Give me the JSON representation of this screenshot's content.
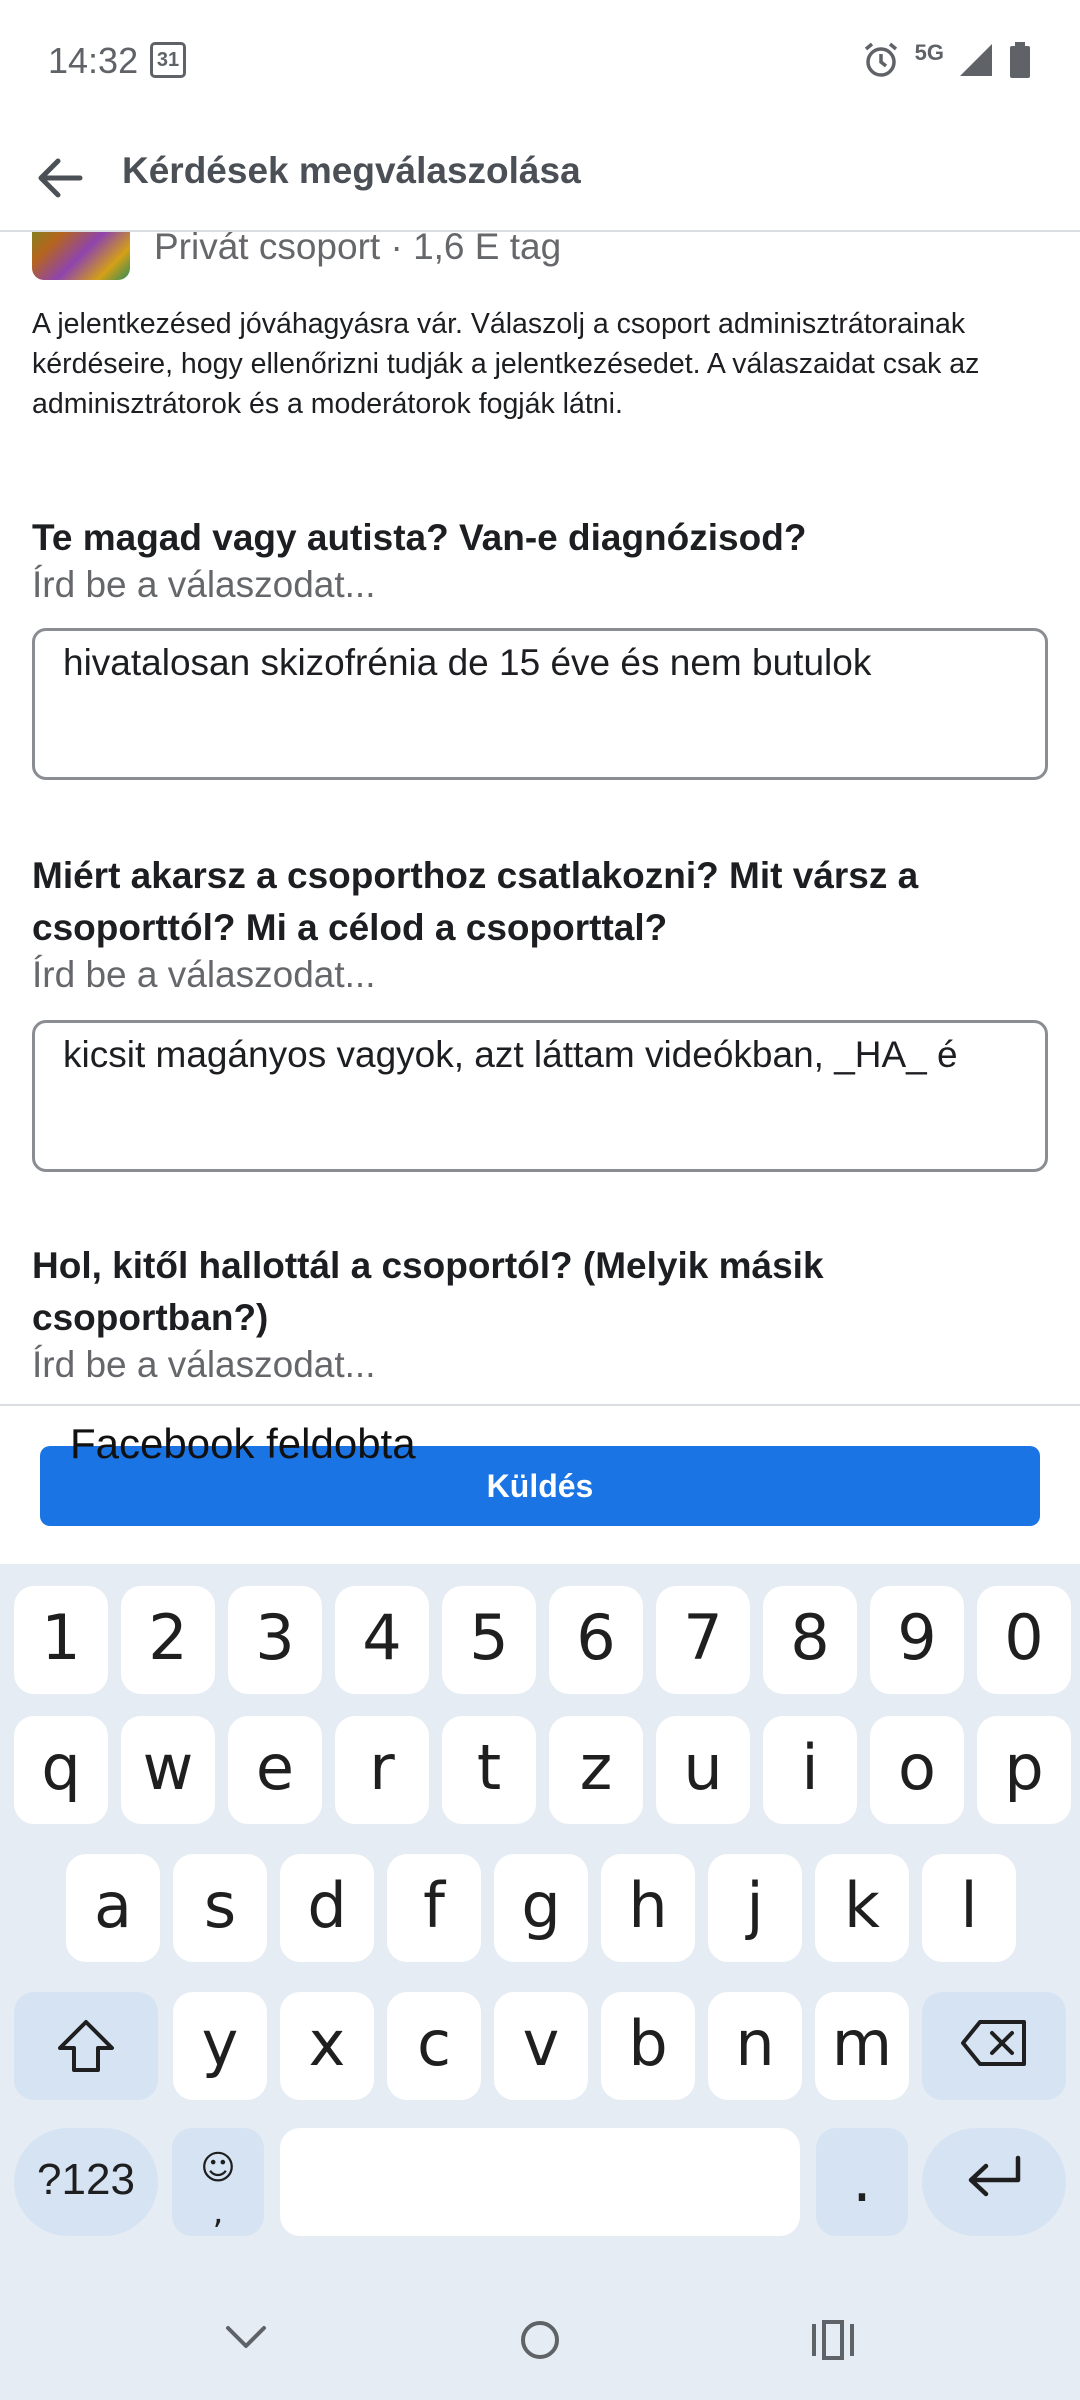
{
  "status_bar": {
    "time": "14:32",
    "calendar_day": "31",
    "network": "5G"
  },
  "header": {
    "title": "Kérdések megválaszolása"
  },
  "group": {
    "meta": "Privát csoport · 1,6 E tag"
  },
  "intro_text": "A jelentkezésed jóváhagyásra vár. Válaszolj a csoport adminisztrátorainak kérdéseire, hogy ellenőrizni tudják a jelentkezésedet. A válaszaidat csak az adminisztrátorok és a moderátorok fogják látni.",
  "questions": [
    {
      "title": "Te magad vagy autista? Van-e diagnózisod?",
      "hint": "Írd be a válaszodat...",
      "answer": "hivatalosan skizofrénia de 15 éve és nem butulok"
    },
    {
      "title": "Miért akarsz a csoporthoz csatlakozni? Mit vársz a csoporttól? Mi a célod a csoporttal?",
      "hint": "Írd be a válaszodat...",
      "answer": "kicsit magányos vagyok, azt láttam videókban, _HA_ é"
    },
    {
      "title": "Hol, kitől hallottál a csoportól? (Melyik másik csoportban?)",
      "hint": "Írd be a válaszodat...",
      "answer": "Facebook feldobta"
    }
  ],
  "submit_label": "Küldés",
  "keyboard": {
    "numbers": [
      "1",
      "2",
      "3",
      "4",
      "5",
      "6",
      "7",
      "8",
      "9",
      "0"
    ],
    "row1": [
      "q",
      "w",
      "e",
      "r",
      "t",
      "z",
      "u",
      "i",
      "o",
      "p"
    ],
    "row2": [
      "a",
      "s",
      "d",
      "f",
      "g",
      "h",
      "j",
      "k",
      "l"
    ],
    "row3": [
      "y",
      "x",
      "c",
      "v",
      "b",
      "n",
      "m"
    ],
    "sym_label": "?123",
    "comma_label": ",",
    "period_label": "."
  }
}
